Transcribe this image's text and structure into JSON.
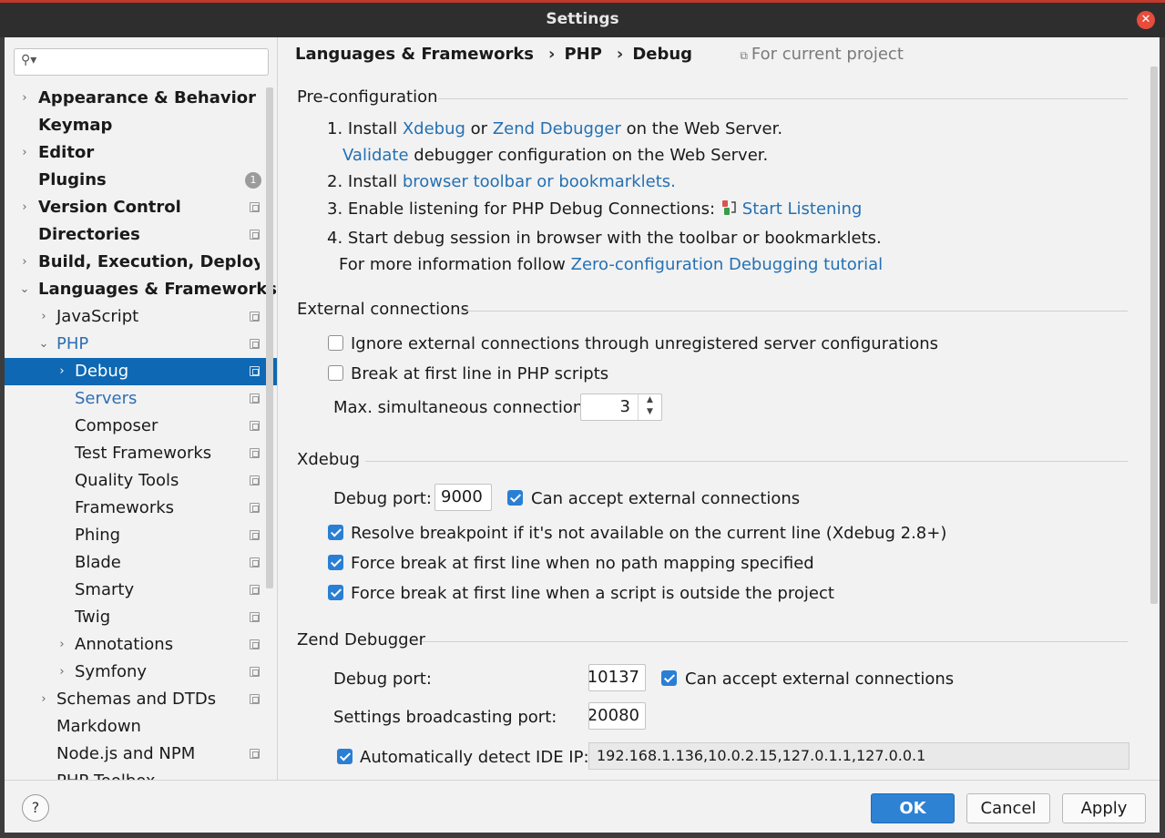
{
  "window": {
    "title": "Settings"
  },
  "search": {
    "placeholder": ""
  },
  "sidebar": {
    "items": [
      {
        "label": "Appearance & Behavior"
      },
      {
        "label": "Keymap"
      },
      {
        "label": "Editor"
      },
      {
        "label": "Plugins",
        "badge": "1"
      },
      {
        "label": "Version Control"
      },
      {
        "label": "Directories"
      },
      {
        "label": "Build, Execution, Deployment"
      },
      {
        "label": "Languages & Frameworks"
      },
      {
        "label": "JavaScript"
      },
      {
        "label": "PHP"
      },
      {
        "label": "Debug"
      },
      {
        "label": "Servers"
      },
      {
        "label": "Composer"
      },
      {
        "label": "Test Frameworks"
      },
      {
        "label": "Quality Tools"
      },
      {
        "label": "Frameworks"
      },
      {
        "label": "Phing"
      },
      {
        "label": "Blade"
      },
      {
        "label": "Smarty"
      },
      {
        "label": "Twig"
      },
      {
        "label": "Annotations"
      },
      {
        "label": "Symfony"
      },
      {
        "label": "Schemas and DTDs"
      },
      {
        "label": "Markdown"
      },
      {
        "label": "Node.js and NPM"
      },
      {
        "label": "PHP Toolbox"
      }
    ]
  },
  "breadcrumb": {
    "items": [
      "Languages & Frameworks",
      "PHP",
      "Debug"
    ],
    "separator": "›",
    "scope": "For current project"
  },
  "preconfig": {
    "heading": "Pre-configuration",
    "step1_prefix": "1. Install",
    "step1_link1": "Xdebug",
    "step1_or": "or",
    "step1_link2": "Zend Debugger",
    "step1_suffix": "on the Web Server.",
    "validate_link": "Validate",
    "validate_suffix": "debugger configuration on the Web Server.",
    "step2_prefix": "2. Install",
    "step2_link": "browser toolbar or bookmarklets.",
    "step3_prefix": "3. Enable listening for PHP Debug Connections:",
    "step3_link": "Start Listening",
    "step4": "4. Start debug session in browser with the toolbar or bookmarklets.",
    "more_prefix": "For more information follow",
    "more_link": "Zero-configuration Debugging tutorial"
  },
  "external": {
    "heading": "External connections",
    "ignore_label": "Ignore external connections through unregistered server configurations",
    "ignore_checked": false,
    "break_label": "Break at first line in PHP scripts",
    "break_checked": false,
    "max_label": "Max. simultaneous connections:",
    "max_value": "3"
  },
  "xdebug": {
    "heading": "Xdebug",
    "port_label": "Debug port:",
    "port_value": "9000",
    "accept_label": "Can accept external connections",
    "accept_checked": true,
    "resolve_label": "Resolve breakpoint if it's not available on the current line (Xdebug 2.8+)",
    "resolve_checked": true,
    "force_nopath_label": "Force break at first line when no path mapping specified",
    "force_nopath_checked": true,
    "force_outside_label": "Force break at first line when a script is outside the project",
    "force_outside_checked": true
  },
  "zend": {
    "heading": "Zend Debugger",
    "port_label": "Debug port:",
    "port_value": "10137",
    "accept_label": "Can accept external connections",
    "accept_checked": true,
    "broadcast_label": "Settings broadcasting port:",
    "broadcast_value": "20080",
    "autodetect_label": "Automatically detect IDE IP:",
    "autodetect_checked": true,
    "ip_value": "192.168.1.136,10.0.2.15,127.0.1.1,127.0.0.1"
  },
  "footer": {
    "help": "?",
    "ok": "OK",
    "cancel": "Cancel",
    "apply": "Apply"
  },
  "colors": {
    "accent": "#0e68b3",
    "link": "#2470b3",
    "titlebar_close": "#e74c3c"
  }
}
